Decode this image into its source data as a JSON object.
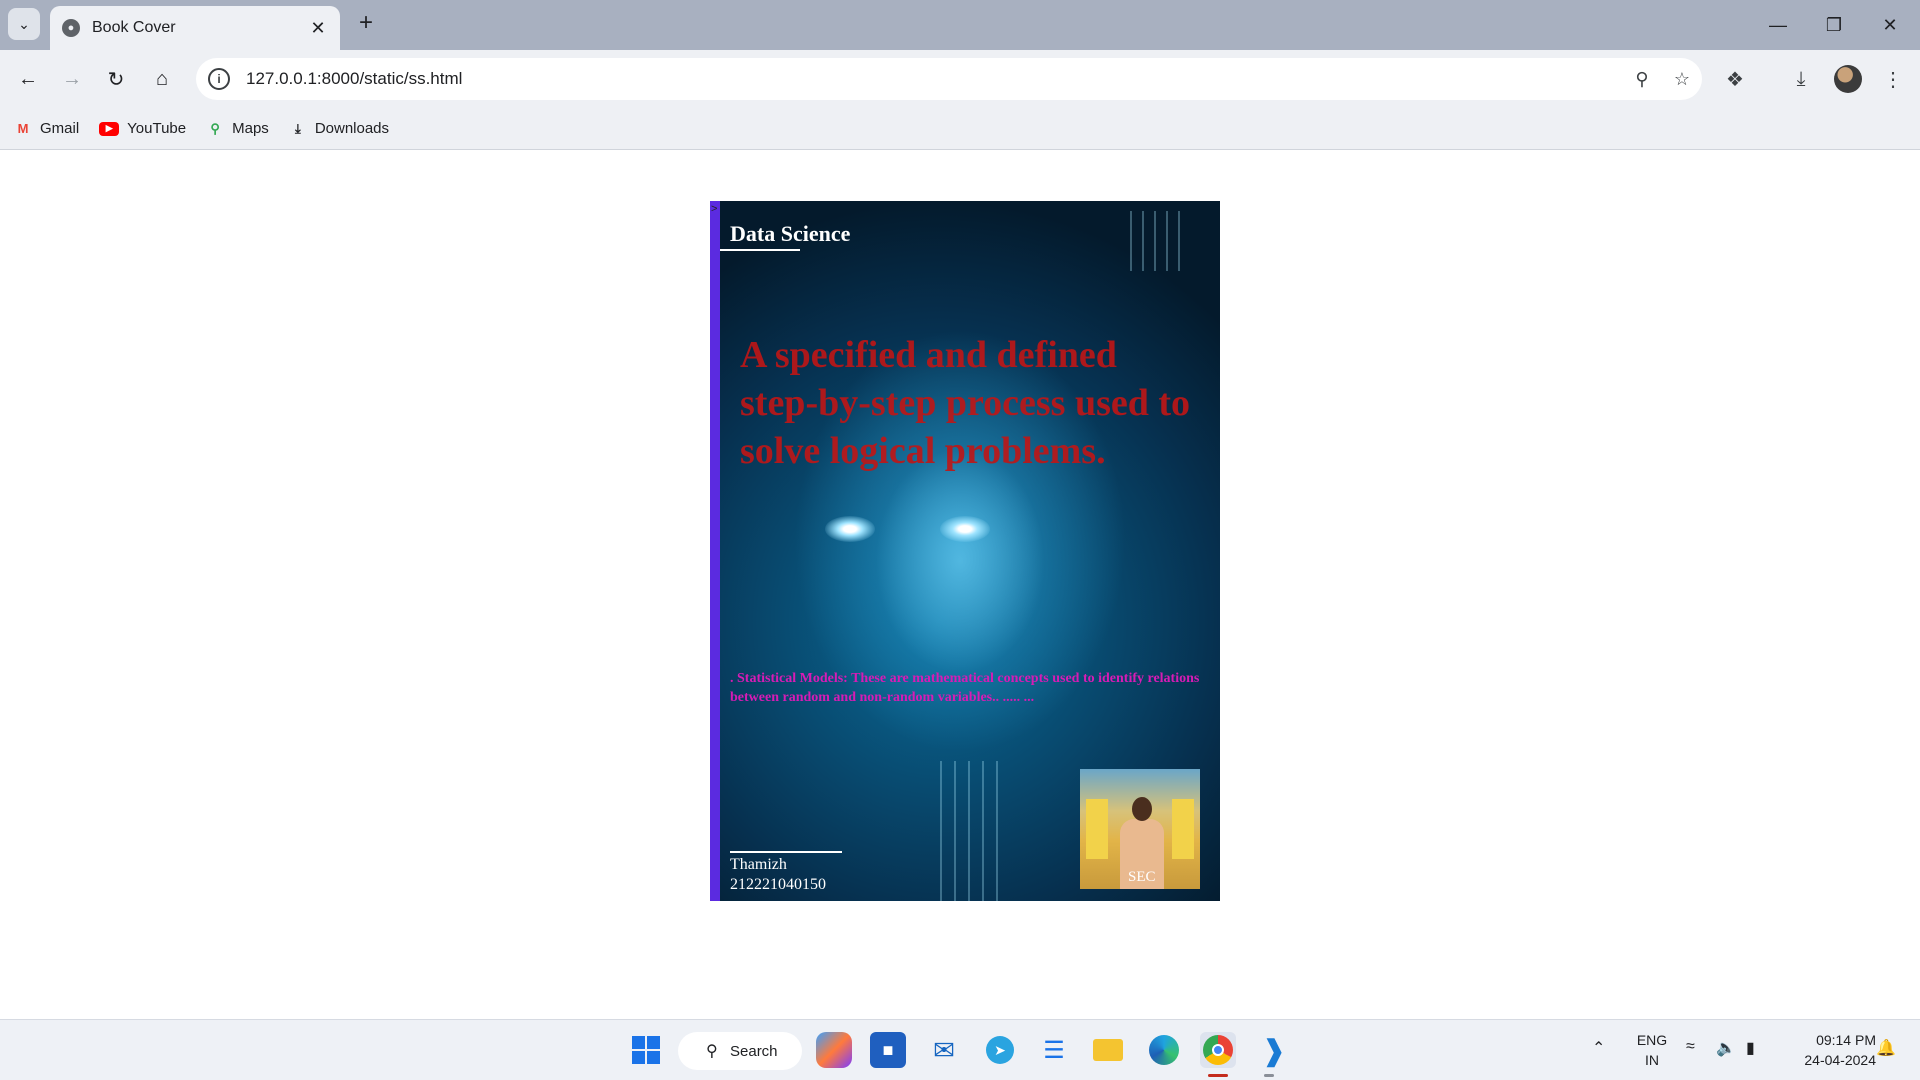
{
  "browser": {
    "tab_title": "Book Cover",
    "url": "127.0.0.1:8000/static/ss.html",
    "bookmarks": [
      {
        "label": "Gmail",
        "icon": "gmail-icon"
      },
      {
        "label": "YouTube",
        "icon": "youtube-icon"
      },
      {
        "label": "Maps",
        "icon": "maps-icon"
      },
      {
        "label": "Downloads",
        "icon": "download-icon"
      }
    ]
  },
  "cover": {
    "title": "Data Science",
    "headline": "A specified and defined step-by-step process used to solve logical problems.",
    "blurb": ". Statistical Models: These are mathematical concepts used to identify relations between random and non-random variables.. ..... ...",
    "author_name": "Thamizh",
    "author_id": "212221040150",
    "photo_label": "SEC",
    "spine_mark": ">"
  },
  "taskbar": {
    "search_label": "Search",
    "language": "ENG",
    "region": "IN",
    "time": "09:14 PM",
    "date": "24-04-2024"
  },
  "colors": {
    "spine": "#5b2be0",
    "headline": "#c01616",
    "blurb": "#d81bb5"
  }
}
